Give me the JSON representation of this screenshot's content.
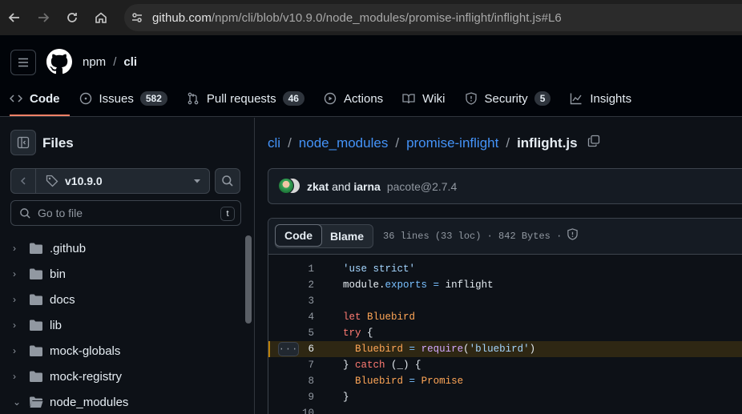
{
  "browser": {
    "url_host": "github.com",
    "url_path": "/npm/cli/blob/v10.9.0/node_modules/promise-inflight/inflight.js#L6"
  },
  "header": {
    "owner": "npm",
    "repo": "cli",
    "tabs": [
      {
        "label": "Code",
        "icon": "code-icon"
      },
      {
        "label": "Issues",
        "count": "582",
        "icon": "issue-icon"
      },
      {
        "label": "Pull requests",
        "count": "46",
        "icon": "pull-request-icon"
      },
      {
        "label": "Actions",
        "icon": "play-icon"
      },
      {
        "label": "Wiki",
        "icon": "book-icon"
      },
      {
        "label": "Security",
        "count": "5",
        "icon": "shield-icon"
      },
      {
        "label": "Insights",
        "icon": "graph-icon"
      }
    ]
  },
  "sidebar": {
    "title": "Files",
    "branch": "v10.9.0",
    "goto_placeholder": "Go to file",
    "goto_shortcut": "t",
    "tree": [
      {
        "name": ".github",
        "expanded": false
      },
      {
        "name": "bin",
        "expanded": false
      },
      {
        "name": "docs",
        "expanded": false
      },
      {
        "name": "lib",
        "expanded": false
      },
      {
        "name": "mock-globals",
        "expanded": false
      },
      {
        "name": "mock-registry",
        "expanded": false
      },
      {
        "name": "node_modules",
        "expanded": true
      }
    ]
  },
  "main": {
    "path": [
      "cli",
      "node_modules",
      "promise-inflight"
    ],
    "filename": "inflight.js",
    "commit": {
      "author1": "zkat",
      "joiner": "and",
      "author2": "iarna",
      "message": "pacote@2.7.4"
    },
    "file": {
      "tab_code": "Code",
      "tab_blame": "Blame",
      "info": "36 lines (33 loc) · 842 Bytes ·"
    },
    "lines": [
      {
        "n": "1"
      },
      {
        "n": "2"
      },
      {
        "n": "3"
      },
      {
        "n": "4"
      },
      {
        "n": "5"
      },
      {
        "n": "6"
      },
      {
        "n": "7"
      },
      {
        "n": "8"
      },
      {
        "n": "9"
      },
      {
        "n": "10"
      }
    ],
    "highlighted_line": "6"
  },
  "colors": {
    "accent_link": "#4493f8",
    "tab_underline": "#f78166",
    "highlight_line": "#2e2713"
  }
}
